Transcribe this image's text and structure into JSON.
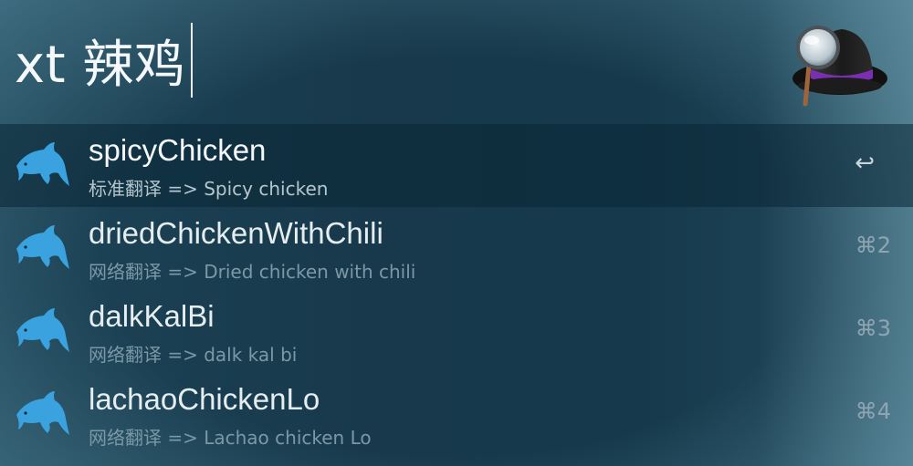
{
  "query": {
    "text": "xt 辣鸡"
  },
  "results": [
    {
      "title": "spicyChicken",
      "subtitle": "标准翻译 => Spicy chicken",
      "shortcut": "↩",
      "icon": "dolphin-icon",
      "selected": true
    },
    {
      "title": "driedChickenWithChili",
      "subtitle": "网络翻译 => Dried chicken with chili",
      "shortcut": "⌘2",
      "icon": "dolphin-icon",
      "selected": false
    },
    {
      "title": "dalkKalBi",
      "subtitle": "网络翻译 => dalk kal bi",
      "shortcut": "⌘3",
      "icon": "dolphin-icon",
      "selected": false
    },
    {
      "title": "lachaoChickenLo",
      "subtitle": "网络翻译 => Lachao chicken Lo",
      "shortcut": "⌘4",
      "icon": "dolphin-icon",
      "selected": false
    }
  ],
  "colors": {
    "accent_icon": "#3aa3df",
    "hat_band": "#7a2fb0",
    "selected_row": "#0d2a38"
  }
}
